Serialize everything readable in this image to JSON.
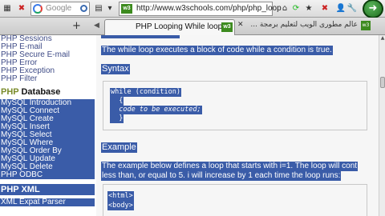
{
  "toolbar": {
    "search_placeholder": "Google",
    "address": "http://www.w3schools.com/php/php_loop",
    "site_badge": "w3"
  },
  "tabs": {
    "active_title": "PHP Looping While loops",
    "other_title": "عالم مطورى الويب لتعليم برمجة ...",
    "favicon": "w3"
  },
  "sidebar": {
    "top_items": [
      "PHP Sessions",
      "PHP E-mail",
      "PHP Secure E-mail",
      "PHP Error",
      "PHP Exception",
      "PHP Filter"
    ],
    "database_heading_prefix": "PHP",
    "database_heading_rest": " Database",
    "database_items": [
      "MySQL Introduction",
      "MySQL Connect",
      "MySQL Create",
      "MySQL Insert",
      "MySQL Select",
      "MySQL Where",
      "MySQL Order By",
      "MySQL Update",
      "MySQL Delete",
      "PHP ODBC"
    ],
    "xml_heading": "PHP XML",
    "xml_items": [
      "XML Expat Parser"
    ]
  },
  "main": {
    "intro": "The while loop executes a block of code while a condition is true.",
    "syntax_label": "Syntax",
    "syntax_lines": [
      "while (condition)",
      "  {",
      "  code to be executed;",
      "  }"
    ],
    "example_label": "Example",
    "example_desc_lines": [
      "The example below defines a loop that starts with i=1. The loop will cont",
      "less than, or equal to 5. i will increase by 1 each time the loop runs:"
    ],
    "example_code_lines": [
      "<html>",
      "<body>"
    ]
  }
}
